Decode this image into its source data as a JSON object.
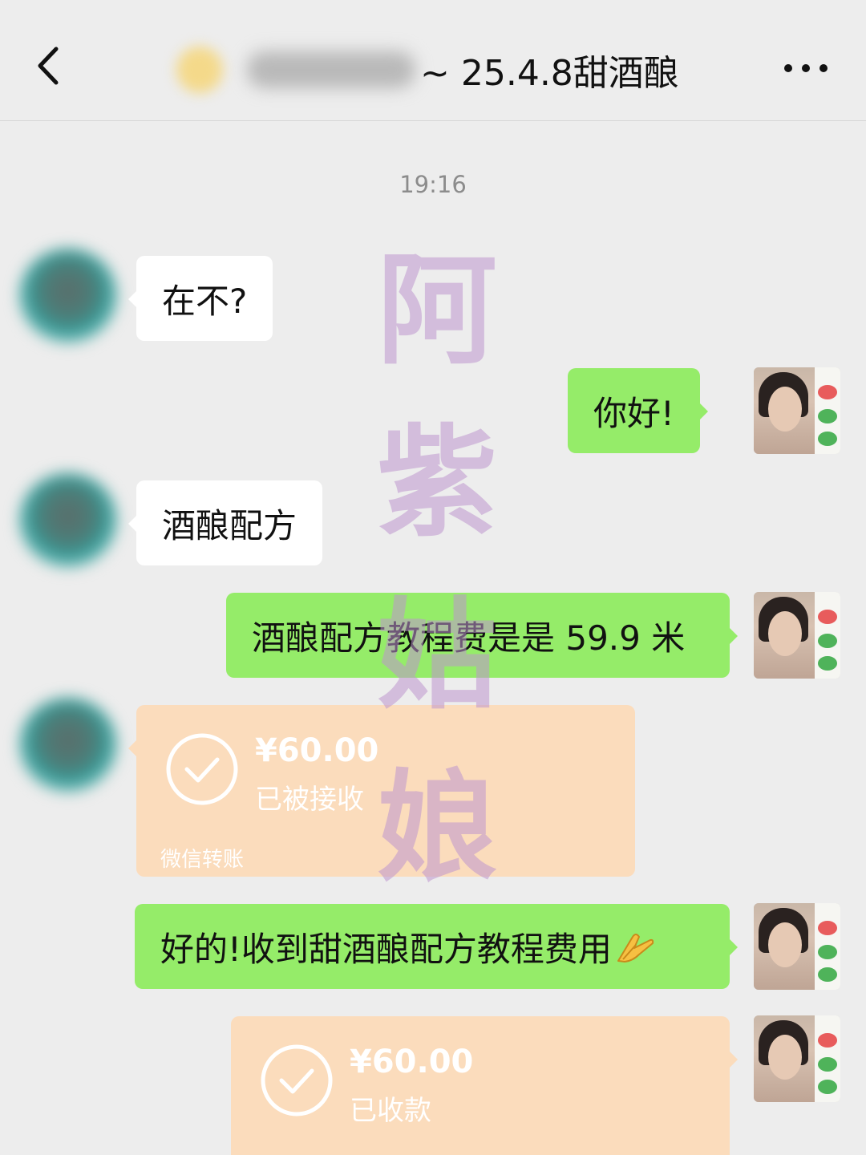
{
  "header": {
    "title_suffix": "~ 25.4.8甜酒酿"
  },
  "timestamp": "19:16",
  "messages": [
    {
      "side": "in",
      "text": "在不?"
    },
    {
      "side": "out",
      "text": "你好!"
    },
    {
      "side": "in",
      "text": "酒酿配方"
    },
    {
      "side": "out",
      "text": "酒酿配方教程费是是 59.9 米"
    },
    {
      "side": "in",
      "type": "transfer",
      "amount": "¥60.00",
      "status": "已被接收",
      "footer": "微信转账"
    },
    {
      "side": "out",
      "text": "好的!收到甜酒酿配方教程费用",
      "emoji": "hands-icon"
    },
    {
      "side": "out",
      "type": "transfer",
      "amount": "¥60.00",
      "status": "已收款"
    }
  ],
  "watermark": [
    "阿",
    "紫",
    "姑",
    "娘"
  ],
  "colors": {
    "background": "#ededed",
    "incoming_bubble": "#ffffff",
    "outgoing_bubble": "#95ec69",
    "transfer_card": "#fbdcbc",
    "watermark": "#be96cd"
  }
}
